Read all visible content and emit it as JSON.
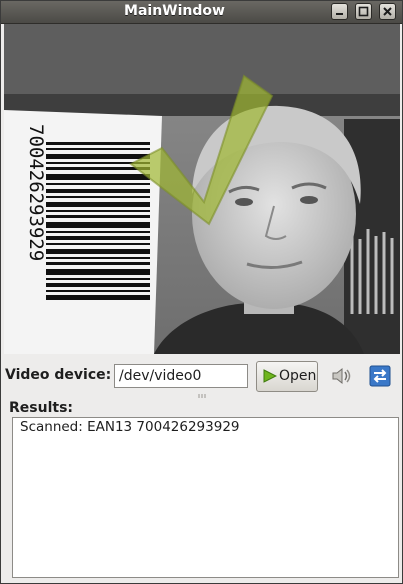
{
  "window": {
    "title": "MainWindow",
    "controls": [
      "minimize-icon",
      "maximize-icon",
      "close-icon"
    ]
  },
  "camera_view": {
    "barcode_digits": "700426293929",
    "overlay": "check-mark-icon",
    "overlay_color": "#a0b832"
  },
  "toolbar": {
    "video_device_label": "Video device:",
    "video_device_value": "/dev/video0",
    "open_label": "Open",
    "sound_icon": "speaker-icon",
    "switch_icon": "switch-icon"
  },
  "results": {
    "label": "Results:",
    "lines": [
      "Scanned: EAN13 700426293929"
    ]
  },
  "colors": {
    "titlebar": "#55534e",
    "window_bg": "#edeceb",
    "play_green": "#6fb51e",
    "switch_blue": "#3a78c8"
  }
}
